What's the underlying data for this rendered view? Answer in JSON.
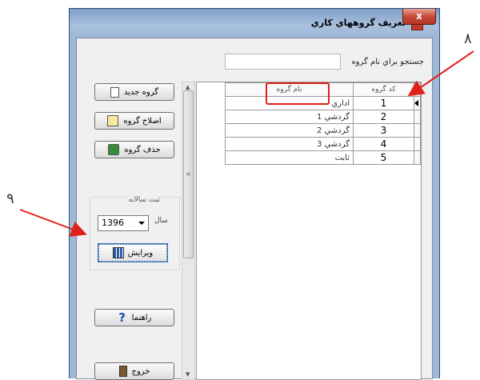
{
  "window": {
    "title": "تعريف گروههاي كاري",
    "close_label": "x"
  },
  "search": {
    "label": "جستجو براي نام گروه",
    "value": ""
  },
  "grid": {
    "columns": [
      "كد گروه",
      "نام گروه"
    ],
    "rows": [
      {
        "code": "1",
        "name": "اداري"
      },
      {
        "code": "2",
        "name": "گردشي 1"
      },
      {
        "code": "3",
        "name": "گردشي 2"
      },
      {
        "code": "4",
        "name": "گردشي 3"
      },
      {
        "code": "5",
        "name": "ثابت"
      }
    ],
    "selected_row": 1
  },
  "sidebar": {
    "new_group": "گروه جديد",
    "edit_group": "اصلاح گروه",
    "delete_group": "حذف گروه",
    "annual_box_title": "ثبت سالانه",
    "year_label": "سال",
    "year_value": "1396",
    "edit_button": "ويرايش",
    "help_button": "راهنما",
    "exit_button": "خروج"
  },
  "annotations": {
    "label_8": "۸",
    "label_9": "۹",
    "arrow_color": "#e0201a"
  },
  "colors": {
    "accent": "#e0201a",
    "title_bar": "#9fb8d6"
  }
}
